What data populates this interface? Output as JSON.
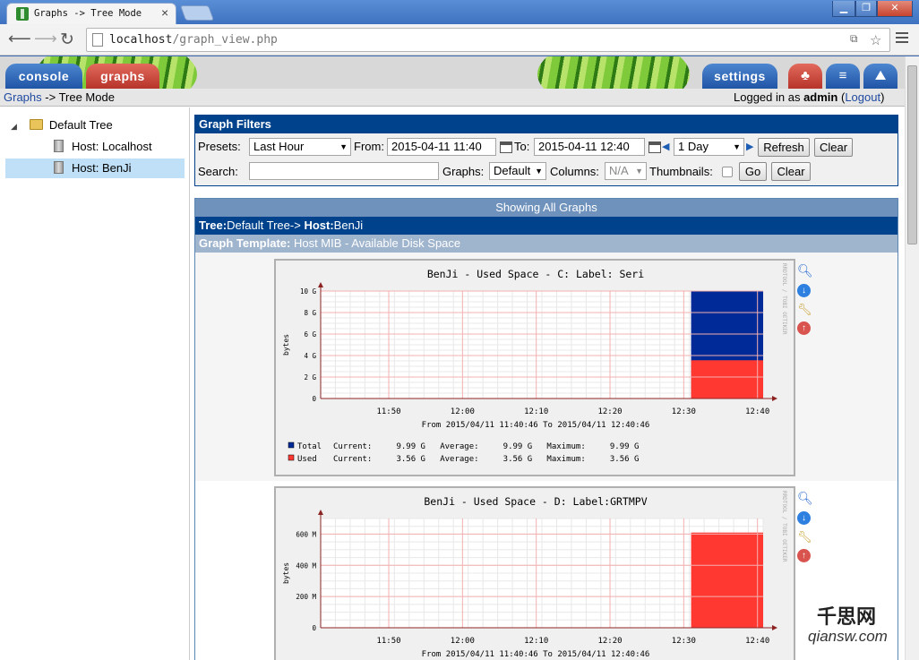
{
  "browser": {
    "tab_title": "Graphs -> Tree Mode",
    "tab_close": "×",
    "url_host": "localhost",
    "url_path": "/graph_view.php"
  },
  "nav": {
    "console": "console",
    "graphs": "graphs",
    "settings": "settings"
  },
  "breadcrumb": {
    "root": "Graphs",
    "sep": " -> ",
    "current": "Tree Mode",
    "logged_in_prefix": "Logged in as ",
    "user": "admin",
    "logout": "Logout"
  },
  "tree": {
    "root": "Default Tree",
    "hosts": [
      "Host: Localhost",
      "Host: BenJi"
    ],
    "selected": 1,
    "expander": "◢"
  },
  "filters": {
    "header": "Graph Filters",
    "presets_label": "Presets:",
    "presets_value": "Last Hour",
    "from_label": "From:",
    "from_value": "2015-04-11 11:40",
    "to_label": "To:",
    "to_value": "2015-04-11 12:40",
    "span_value": "1 Day",
    "refresh": "Refresh",
    "clear": "Clear",
    "search_label": "Search:",
    "search_value": "",
    "graphs_label": "Graphs:",
    "graphs_value": "Default",
    "columns_label": "Columns:",
    "columns_value": "N/A",
    "thumbnails_label": "Thumbnails:",
    "go": "Go",
    "clear2": "Clear"
  },
  "listing": {
    "showing": "Showing All Graphs",
    "tree_label": "Tree:",
    "tree_value": "Default Tree->",
    "host_label": "Host:",
    "host_value": "BenJi",
    "template_label": "Graph Template:",
    "template_value": "Host MIB - Available Disk Space"
  },
  "graph_side_text": "RRDTOOL / TOBI OETIKER",
  "chart_data": [
    {
      "type": "area",
      "title": "BenJi - Used Space - C: Label:  Seri",
      "ylabel": "bytes",
      "yticks": [
        "0",
        "2 G",
        "4 G",
        "6 G",
        "8 G",
        "10 G"
      ],
      "ylim": [
        0,
        10
      ],
      "xticks": [
        "11:50",
        "12:00",
        "12:10",
        "12:20",
        "12:30",
        "12:40"
      ],
      "xrange": [
        "11:40:46",
        "12:40:46"
      ],
      "subtitle": "From 2015/04/11 11:40:46 To 2015/04/11 12:40:46",
      "series": [
        {
          "name": "Total",
          "color": "#002a97",
          "start": "12:31",
          "value": 9.99
        },
        {
          "name": "Used",
          "color": "#ff3932",
          "start": "12:31",
          "value": 3.56
        }
      ],
      "legend": [
        {
          "name": "Total",
          "color": "#002a97",
          "text": "Current:     9.99 G   Average:     9.99 G   Maximum:     9.99 G"
        },
        {
          "name": "Used",
          "color": "#ff3932",
          "text": "Current:     3.56 G   Average:     3.56 G   Maximum:     3.56 G"
        }
      ]
    },
    {
      "type": "area",
      "title": "BenJi - Used Space - D: Label:GRTMPV",
      "ylabel": "bytes",
      "yticks": [
        "0",
        "200 M",
        "400 M",
        "600 M"
      ],
      "ylim": [
        0,
        700
      ],
      "xticks": [
        "11:50",
        "12:00",
        "12:10",
        "12:20",
        "12:30",
        "12:40"
      ],
      "xrange": [
        "11:40:46",
        "12:40:46"
      ],
      "subtitle": "From 2015/04/11 11:40:46 To 2015/04/11 12:40:46",
      "series": [
        {
          "color": "#ff3932",
          "start": "12:31",
          "value": 610
        }
      ]
    }
  ],
  "watermark": {
    "cn": "千思网",
    "en": "qiansw.com"
  }
}
